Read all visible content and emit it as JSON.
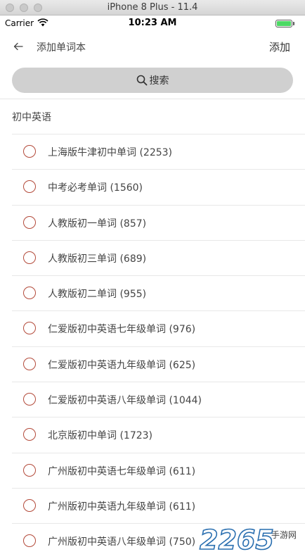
{
  "simulator": {
    "title": "iPhone 8 Plus - 11.4"
  },
  "status_bar": {
    "carrier": "Carrier",
    "time": "10:23 AM"
  },
  "nav": {
    "back_icon": "back-arrow-icon",
    "title": "添加单词本",
    "action_label": "添加"
  },
  "search": {
    "icon": "search-icon",
    "label": "搜索"
  },
  "section": {
    "title": "初中英语"
  },
  "books": [
    {
      "label": "上海版牛津初中单词 (2253)",
      "selected": false
    },
    {
      "label": "中考必考单词 (1560)",
      "selected": false
    },
    {
      "label": "人教版初一单词 (857)",
      "selected": false
    },
    {
      "label": "人教版初三单词 (689)",
      "selected": false
    },
    {
      "label": "人教版初二单词 (955)",
      "selected": false
    },
    {
      "label": "仁爱版初中英语七年级单词 (976)",
      "selected": false
    },
    {
      "label": "仁爱版初中英语九年级单词 (625)",
      "selected": false
    },
    {
      "label": "仁爱版初中英语八年级单词 (1044)",
      "selected": false
    },
    {
      "label": "北京版初中单词 (1723)",
      "selected": false
    },
    {
      "label": "广州版初中英语七年级单词 (611)",
      "selected": false
    },
    {
      "label": "广州版初中英语九年级单词 (611)",
      "selected": false
    },
    {
      "label": "广州版初中英语八年级单词 (750)",
      "selected": false
    }
  ],
  "colors": {
    "radio_border": "#b34a3a",
    "search_bg": "#d0d0d0",
    "battery": "#4cd964"
  },
  "watermark": {
    "brand": "2265",
    "sub": "手游网"
  }
}
